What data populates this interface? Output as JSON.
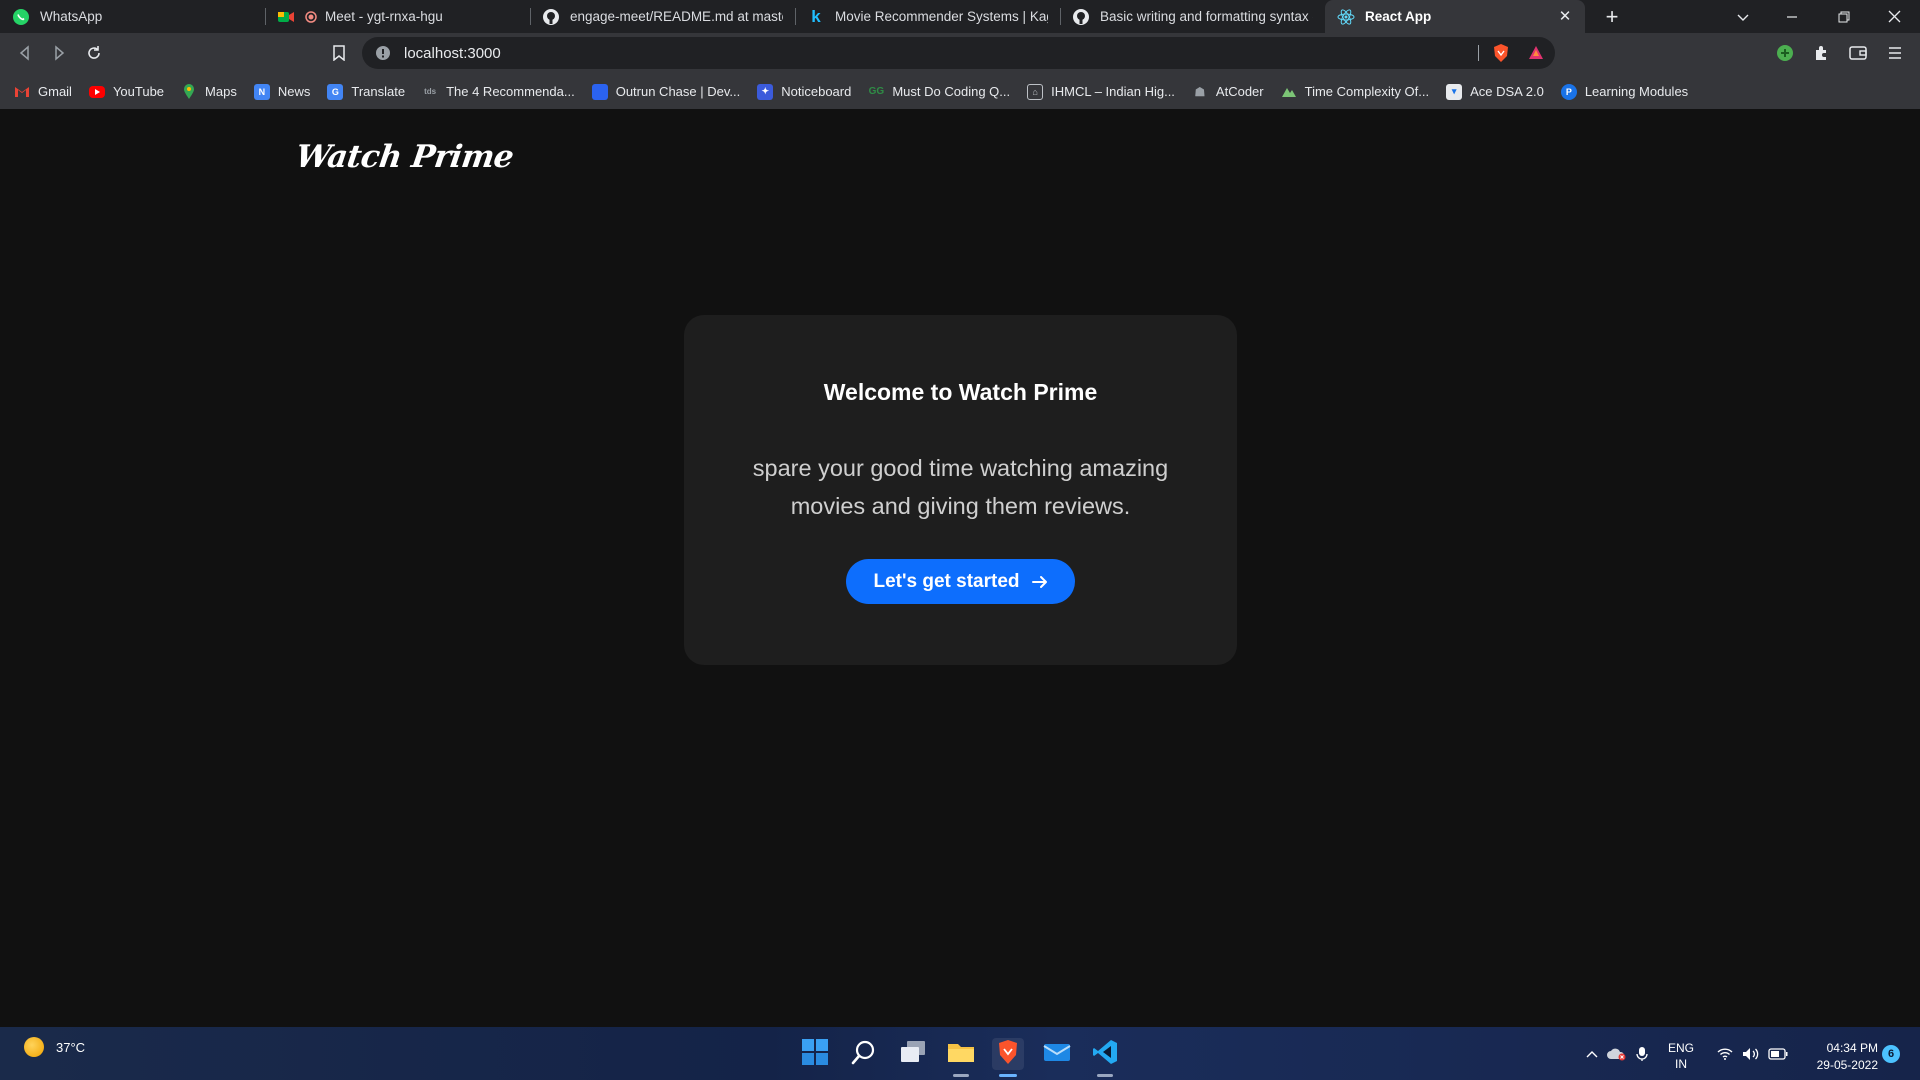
{
  "browser": {
    "tabs": [
      {
        "title": "WhatsApp",
        "icon": "whatsapp-icon"
      },
      {
        "title": "Meet - ygt-rnxa-hgu",
        "icon": "meet-icon"
      },
      {
        "title": "engage-meet/README.md at master",
        "icon": "github-icon"
      },
      {
        "title": "Movie Recommender Systems | Kaggle",
        "icon": "kaggle-icon"
      },
      {
        "title": "Basic writing and formatting syntax - GitHub Docs",
        "icon": "github-icon"
      },
      {
        "title": "React App",
        "icon": "react-icon",
        "active": true
      }
    ],
    "address": "localhost:3000",
    "bookmarks": [
      {
        "label": "Gmail",
        "icon": "gmail-icon"
      },
      {
        "label": "YouTube",
        "icon": "youtube-icon"
      },
      {
        "label": "Maps",
        "icon": "maps-icon"
      },
      {
        "label": "News",
        "icon": "news-icon"
      },
      {
        "label": "Translate",
        "icon": "translate-icon"
      },
      {
        "label": "The 4 Recommenda...",
        "icon": "tds-icon"
      },
      {
        "label": "Outrun Chase | Dev...",
        "icon": "devpost-icon"
      },
      {
        "label": "Noticeboard",
        "icon": "noticeboard-icon"
      },
      {
        "label": "Must Do Coding Q...",
        "icon": "gfg-icon"
      },
      {
        "label": "IHMCL – Indian Hig...",
        "icon": "ihmcl-icon"
      },
      {
        "label": "AtCoder",
        "icon": "atcoder-icon"
      },
      {
        "label": "Time Complexity Of...",
        "icon": "time-complexity-icon"
      },
      {
        "label": "Ace DSA 2.0",
        "icon": "ace-dsa-icon"
      },
      {
        "label": "Learning Modules",
        "icon": "learning-modules-icon"
      }
    ]
  },
  "page": {
    "brand": "Watch Prime",
    "card": {
      "title": "Welcome to Watch Prime",
      "text": "spare your good time watching amazing movies and giving them reviews.",
      "cta_label": "Let's get started"
    },
    "accent_color": "#0d6efd"
  },
  "taskbar": {
    "weather": "37°C",
    "lang_line1": "ENG",
    "lang_line2": "IN",
    "time": "04:34 PM",
    "date": "29-05-2022",
    "notifications": "6"
  }
}
